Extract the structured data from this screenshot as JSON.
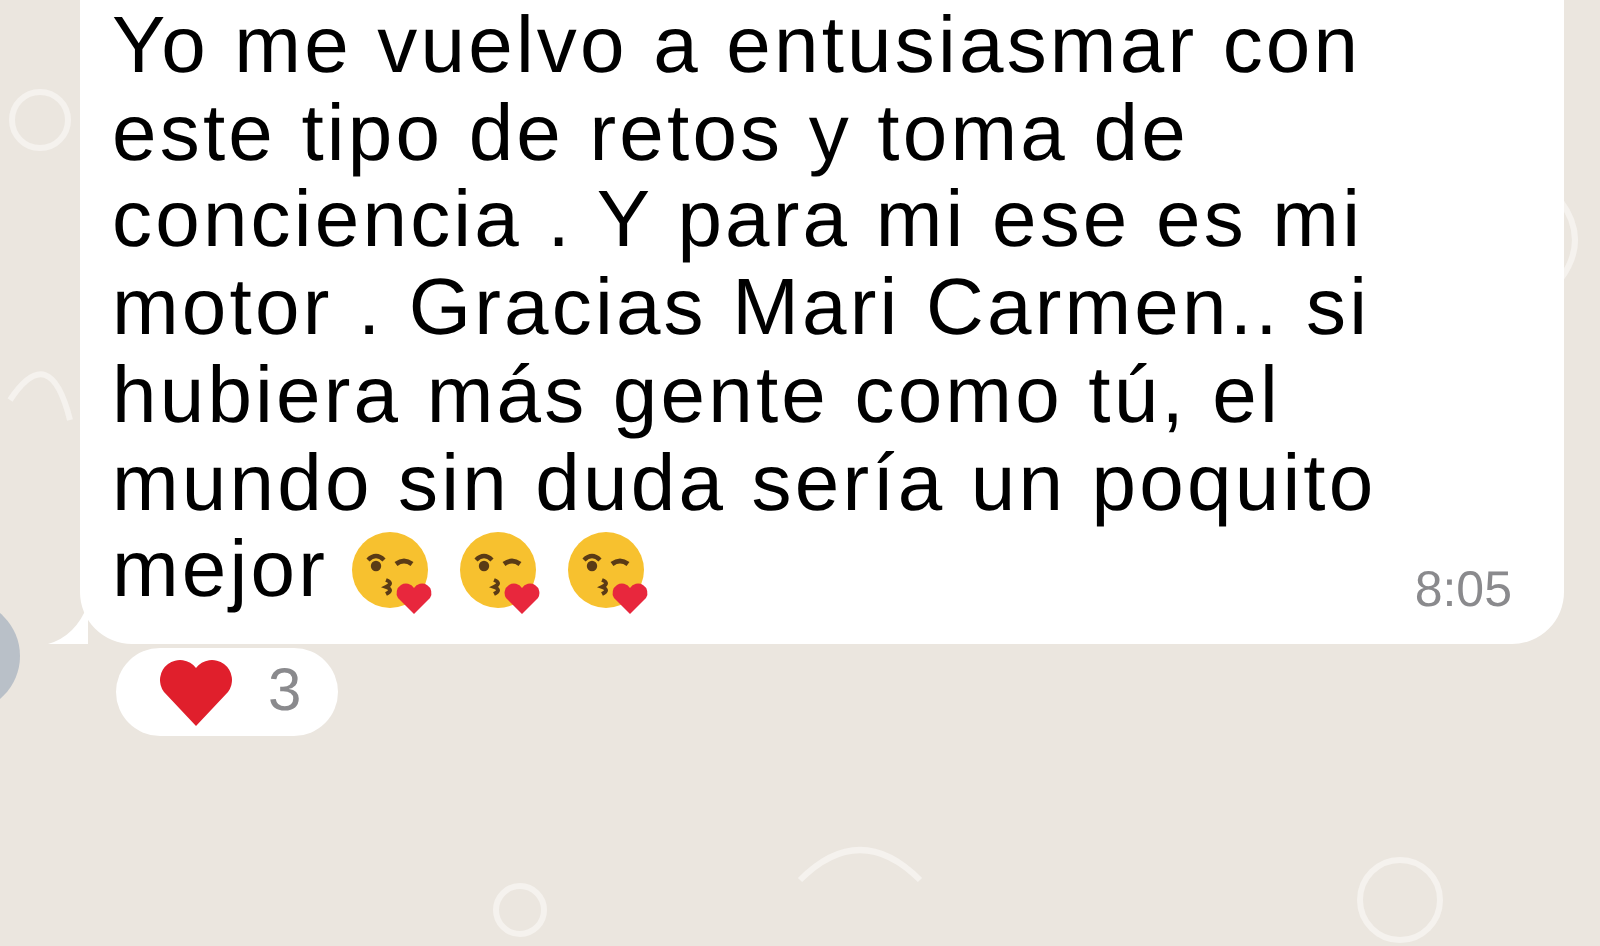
{
  "message": {
    "lines": [
      "Yo me vuelvo a entusiasmar con",
      "este tipo de retos y toma de",
      "conciencia . Y para mi ese es mi",
      "motor . Gracias Mari Carmen.. si",
      "hubiera más gente como tú, el",
      "mundo sin duda sería un poquito",
      "mejor"
    ],
    "emoji": [
      {
        "kind": "kiss-heart"
      },
      {
        "kind": "kiss-heart"
      },
      {
        "kind": "kiss-heart"
      }
    ],
    "time": "8:05"
  },
  "reaction": {
    "kind": "heart",
    "count": "3"
  }
}
